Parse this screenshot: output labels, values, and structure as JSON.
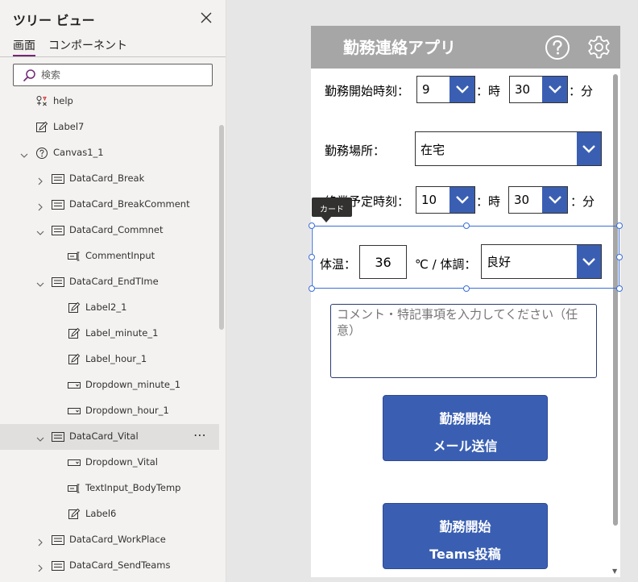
{
  "tree_view": {
    "title": "ツリー ビュー",
    "tabs": [
      "画面",
      "コンポーネント"
    ],
    "search": {
      "placeholder": "検索",
      "value": ""
    },
    "items": [
      {
        "name": "help",
        "icon": "group-icon",
        "indent": 0,
        "expandable": false,
        "expanded": false,
        "selected": false
      },
      {
        "name": "Label7",
        "icon": "label-icon",
        "indent": 0,
        "expandable": false,
        "expanded": false,
        "selected": false
      },
      {
        "name": "Canvas1_1",
        "icon": "help-circle-icon",
        "indent": 0,
        "expandable": true,
        "expanded": true,
        "selected": false
      },
      {
        "name": "DataCard_Break",
        "icon": "card-icon",
        "indent": 1,
        "expandable": true,
        "expanded": false,
        "selected": false
      },
      {
        "name": "DataCard_BreakComment",
        "icon": "card-icon",
        "indent": 1,
        "expandable": true,
        "expanded": false,
        "selected": false
      },
      {
        "name": "DataCard_Commnet",
        "icon": "card-icon",
        "indent": 1,
        "expandable": true,
        "expanded": true,
        "selected": false
      },
      {
        "name": "CommentInput",
        "icon": "text-input-icon",
        "indent": 2,
        "expandable": false,
        "expanded": false,
        "selected": false
      },
      {
        "name": "DataCard_EndTIme",
        "icon": "card-icon",
        "indent": 1,
        "expandable": true,
        "expanded": true,
        "selected": false
      },
      {
        "name": "Label2_1",
        "icon": "label-icon",
        "indent": 2,
        "expandable": false,
        "expanded": false,
        "selected": false
      },
      {
        "name": "Label_minute_1",
        "icon": "label-icon",
        "indent": 2,
        "expandable": false,
        "expanded": false,
        "selected": false
      },
      {
        "name": "Label_hour_1",
        "icon": "label-icon",
        "indent": 2,
        "expandable": false,
        "expanded": false,
        "selected": false
      },
      {
        "name": "Dropdown_minute_1",
        "icon": "dropdown-icon",
        "indent": 2,
        "expandable": false,
        "expanded": false,
        "selected": false
      },
      {
        "name": "Dropdown_hour_1",
        "icon": "dropdown-icon",
        "indent": 2,
        "expandable": false,
        "expanded": false,
        "selected": false
      },
      {
        "name": "DataCard_Vital",
        "icon": "card-icon",
        "indent": 1,
        "expandable": true,
        "expanded": true,
        "selected": true
      },
      {
        "name": "Dropdown_Vital",
        "icon": "dropdown-icon",
        "indent": 2,
        "expandable": false,
        "expanded": false,
        "selected": false
      },
      {
        "name": "TextInput_BodyTemp",
        "icon": "text-input-icon",
        "indent": 2,
        "expandable": false,
        "expanded": false,
        "selected": false
      },
      {
        "name": "Label6",
        "icon": "label-icon",
        "indent": 2,
        "expandable": false,
        "expanded": false,
        "selected": false
      },
      {
        "name": "DataCard_WorkPlace",
        "icon": "card-icon",
        "indent": 1,
        "expandable": true,
        "expanded": false,
        "selected": false
      },
      {
        "name": "DataCard_SendTeams",
        "icon": "card-icon",
        "indent": 1,
        "expandable": true,
        "expanded": false,
        "selected": false
      }
    ],
    "more_label": "⋯"
  },
  "app": {
    "title": "勤務連絡アプリ",
    "header_color": "#a6a6a6",
    "accent_color": "#3a5fb2",
    "start_time": {
      "label": "勤務開始時刻：",
      "hour": "9",
      "hour_unit": "：時",
      "minute": "30",
      "minute_unit": "：分"
    },
    "work_place": {
      "label": "勤務場所：",
      "value": "在宅"
    },
    "end_time": {
      "label": "終業予定時刻：",
      "hour": "10",
      "hour_unit": "：時",
      "minute": "30",
      "minute_unit": "：分"
    },
    "vital": {
      "temp_label": "体温：",
      "temp_value": "36",
      "condition_label": "℃ / 体調：",
      "condition_value": "良好"
    },
    "card_tooltip": "カード",
    "comment": {
      "placeholder": "コメント・特記事項を入力してください（任意）",
      "value": ""
    },
    "mail_button": {
      "line1": "勤務開始",
      "line2": "メール送信"
    },
    "teams_button": {
      "line1": "勤務開始",
      "line2": "Teams投稿"
    }
  }
}
